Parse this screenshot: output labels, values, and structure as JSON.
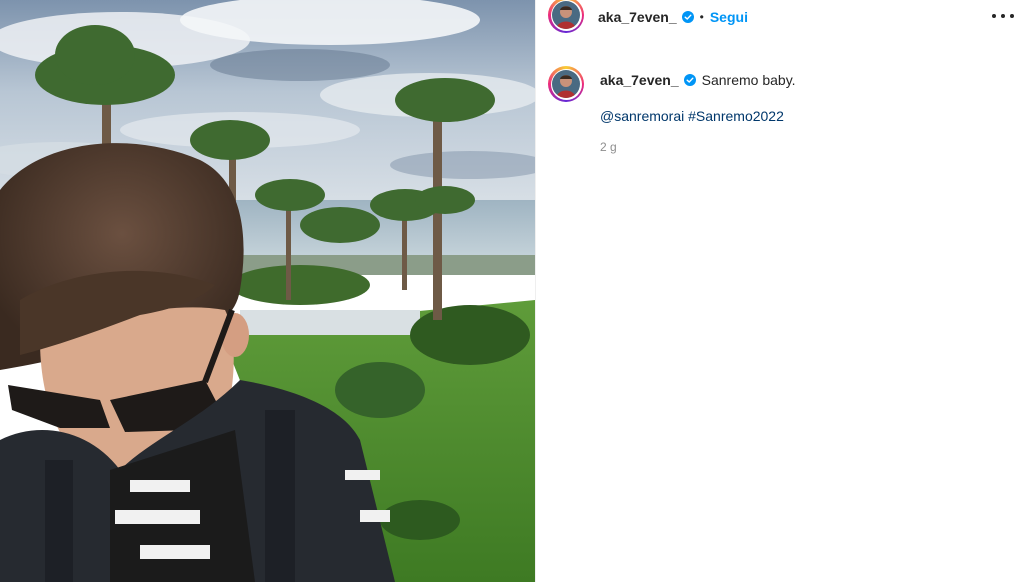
{
  "post": {
    "username": "aka_7even_",
    "separator": "•",
    "follow_label": "Segui",
    "caption": "Sanremo baby.",
    "mention": "@sanremorai",
    "hashtag": "#Sanremo2022",
    "timestamp": "2 g"
  },
  "colors": {
    "accent": "#0095f6",
    "link": "#00376b",
    "muted": "#8e8e8e",
    "text": "#262626"
  },
  "icons": [
    "verified-badge-icon",
    "more-options-icon"
  ]
}
